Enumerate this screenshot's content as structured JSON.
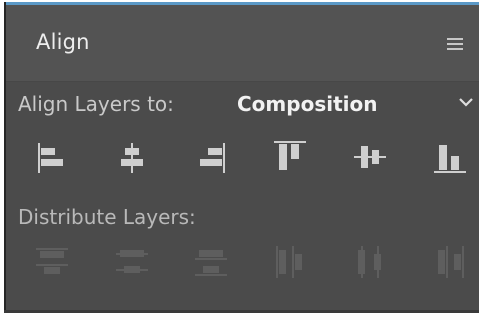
{
  "panel": {
    "title": "Align",
    "menu_icon": "hamburger-menu-icon",
    "accent_color": "#5b99c7",
    "background_color": "#4b4b4b"
  },
  "align_section": {
    "label": "Align Layers to:",
    "dropdown": {
      "selected": "Composition",
      "icon": "chevron-down-icon"
    },
    "buttons": [
      {
        "name": "align-left-icon",
        "label": ""
      },
      {
        "name": "align-horizontal-center-icon",
        "label": ""
      },
      {
        "name": "align-right-icon",
        "label": ""
      },
      {
        "name": "align-top-icon",
        "label": ""
      },
      {
        "name": "align-vertical-center-icon",
        "label": ""
      },
      {
        "name": "align-bottom-icon",
        "label": ""
      }
    ]
  },
  "distribute_section": {
    "label": "Distribute Layers:",
    "enabled": false,
    "buttons": [
      {
        "name": "distribute-top-icon"
      },
      {
        "name": "distribute-vertical-center-icon"
      },
      {
        "name": "distribute-bottom-icon"
      },
      {
        "name": "distribute-left-icon"
      },
      {
        "name": "distribute-horizontal-center-icon"
      },
      {
        "name": "distribute-right-icon"
      }
    ]
  }
}
